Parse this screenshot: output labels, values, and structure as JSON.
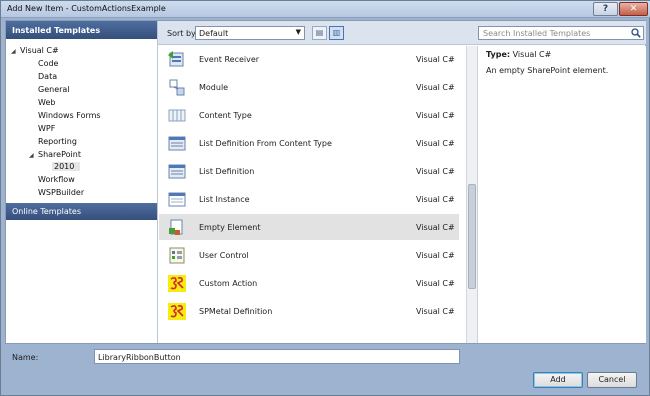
{
  "window": {
    "title": "Add New Item - CustomActionsExample",
    "help_label": "?",
    "close_label": "✕"
  },
  "left": {
    "header": "Installed Templates",
    "tree": [
      {
        "label": "Visual C#",
        "name": "tree-visual-csharp"
      },
      {
        "label": "Code",
        "name": "tree-code"
      },
      {
        "label": "Data",
        "name": "tree-data"
      },
      {
        "label": "General",
        "name": "tree-general"
      },
      {
        "label": "Web",
        "name": "tree-web"
      },
      {
        "label": "Windows Forms",
        "name": "tree-windows-forms"
      },
      {
        "label": "WPF",
        "name": "tree-wpf"
      },
      {
        "label": "Reporting",
        "name": "tree-reporting"
      },
      {
        "label": "SharePoint",
        "name": "tree-sharepoint"
      },
      {
        "label": "2010",
        "name": "tree-2010"
      },
      {
        "label": "Workflow",
        "name": "tree-workflow"
      },
      {
        "label": "WSPBuilder",
        "name": "tree-wspbuilder"
      }
    ],
    "online": "Online Templates"
  },
  "toolbar": {
    "sort_label": "Sort by:",
    "sort_value": "Default",
    "search_placeholder": "Search Installed Templates"
  },
  "templates": [
    {
      "name": "Event Receiver",
      "lang": "Visual C#",
      "icon": "event-receiver-icon"
    },
    {
      "name": "Module",
      "lang": "Visual C#",
      "icon": "module-icon"
    },
    {
      "name": "Content Type",
      "lang": "Visual C#",
      "icon": "content-type-icon"
    },
    {
      "name": "List Definition From Content Type",
      "lang": "Visual C#",
      "icon": "list-definition-icon"
    },
    {
      "name": "List Definition",
      "lang": "Visual C#",
      "icon": "list-definition-icon"
    },
    {
      "name": "List Instance",
      "lang": "Visual C#",
      "icon": "list-instance-icon"
    },
    {
      "name": "Empty Element",
      "lang": "Visual C#",
      "icon": "empty-element-icon"
    },
    {
      "name": "User Control",
      "lang": "Visual C#",
      "icon": "user-control-icon"
    },
    {
      "name": "Custom Action",
      "lang": "Visual C#",
      "icon": "custom-template-icon"
    },
    {
      "name": "SPMetal Definition",
      "lang": "Visual C#",
      "icon": "custom-template-icon"
    }
  ],
  "detail": {
    "type_label": "Type:",
    "type_value": "Visual C#",
    "description": "An empty SharePoint element."
  },
  "bottom": {
    "name_label": "Name:",
    "name_value": "LibraryRibbonButton",
    "add_label": "Add",
    "cancel_label": "Cancel"
  }
}
